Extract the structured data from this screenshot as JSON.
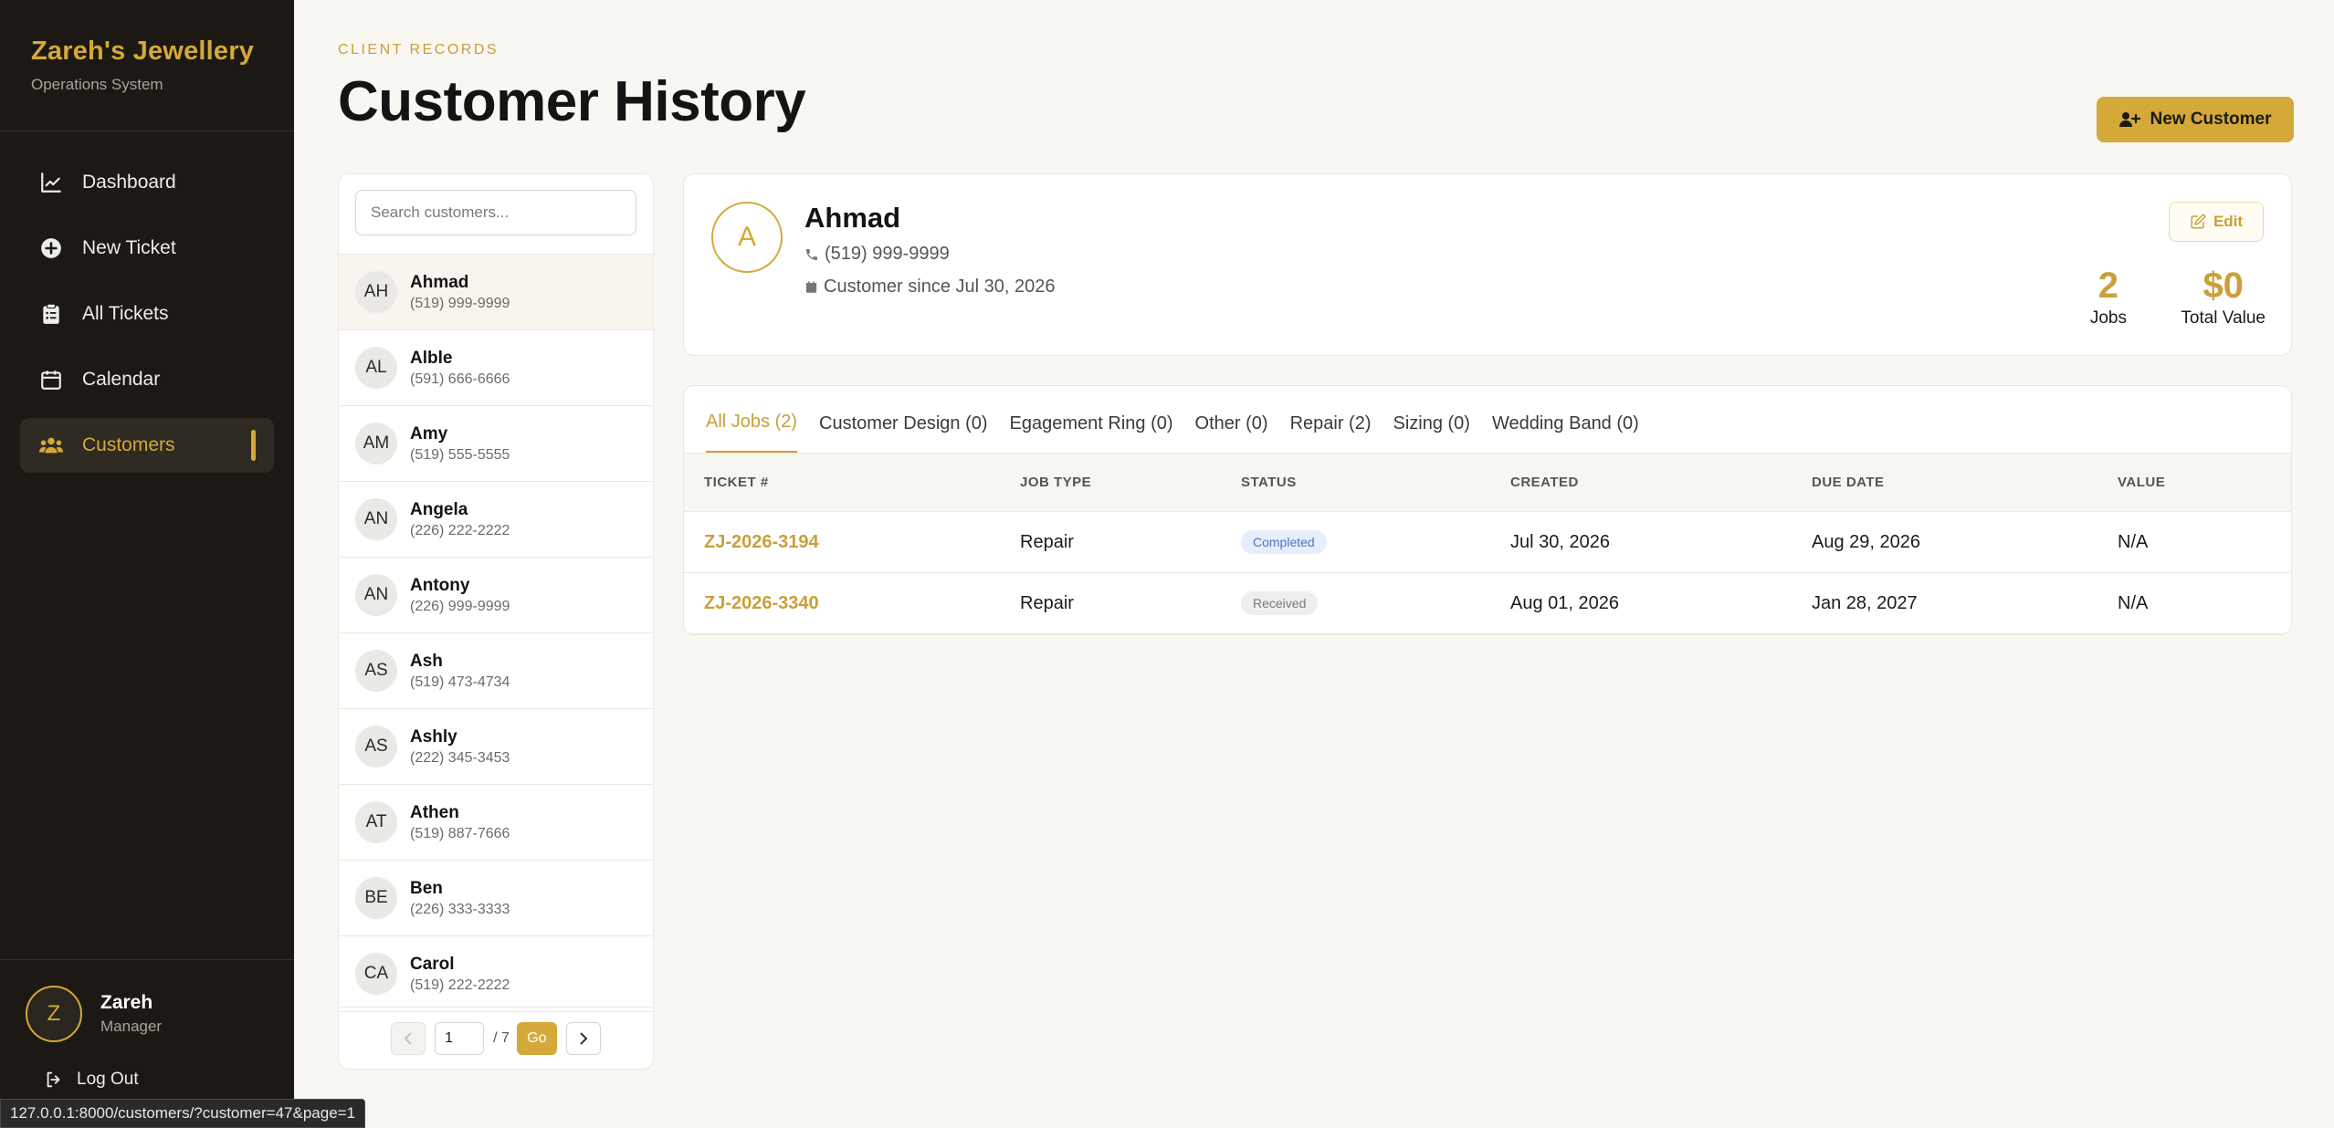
{
  "sidebar": {
    "brand_title": "Zareh's Jewellery",
    "brand_sub": "Operations System",
    "nav": [
      {
        "label": "Dashboard",
        "icon": "chart-line-icon"
      },
      {
        "label": "New Ticket",
        "icon": "plus-circle-icon"
      },
      {
        "label": "All Tickets",
        "icon": "clipboard-list-icon"
      },
      {
        "label": "Calendar",
        "icon": "calendar-icon"
      },
      {
        "label": "Customers",
        "icon": "users-icon",
        "active": true
      }
    ],
    "user": {
      "initial": "Z",
      "name": "Zareh",
      "role": "Manager"
    },
    "logout_label": "Log Out"
  },
  "statusbar": {
    "url": "127.0.0.1:8000/customers/?customer=47&page=1"
  },
  "header": {
    "eyebrow": "CLIENT RECORDS",
    "title": "Customer History",
    "new_customer_label": "New Customer"
  },
  "customer_list": {
    "search_placeholder": "Search customers...",
    "customers": [
      {
        "initials": "AH",
        "name": "Ahmad",
        "phone": "(519) 999-9999",
        "active": true
      },
      {
        "initials": "AL",
        "name": "Alble",
        "phone": "(591) 666-6666"
      },
      {
        "initials": "AM",
        "name": "Amy",
        "phone": "(519) 555-5555"
      },
      {
        "initials": "AN",
        "name": "Angela",
        "phone": "(226) 222-2222"
      },
      {
        "initials": "AN",
        "name": "Antony",
        "phone": "(226) 999-9999"
      },
      {
        "initials": "AS",
        "name": "Ash",
        "phone": "(519) 473-4734"
      },
      {
        "initials": "AS",
        "name": "Ashly",
        "phone": "(222) 345-3453"
      },
      {
        "initials": "AT",
        "name": "Athen",
        "phone": "(519) 887-7666"
      },
      {
        "initials": "BE",
        "name": "Ben",
        "phone": "(226) 333-3333"
      },
      {
        "initials": "CA",
        "name": "Carol",
        "phone": "(519) 222-2222"
      }
    ],
    "pagination": {
      "page": "1",
      "total": "/ 7",
      "go_label": "Go"
    }
  },
  "profile": {
    "initial": "A",
    "name": "Ahmad",
    "phone": "(519) 999-9999",
    "since": "Customer since Jul 30, 2026",
    "edit_label": "Edit",
    "stats": [
      {
        "value": "2",
        "label": "Jobs"
      },
      {
        "value": "$0",
        "label": "Total Value"
      }
    ]
  },
  "jobs": {
    "tabs": [
      {
        "label": "All Jobs (2)",
        "active": true
      },
      {
        "label": "Customer Design (0)"
      },
      {
        "label": "Egagement Ring (0)"
      },
      {
        "label": "Other (0)"
      },
      {
        "label": "Repair (2)"
      },
      {
        "label": "Sizing (0)"
      },
      {
        "label": "Wedding Band (0)"
      }
    ],
    "columns": [
      "TICKET #",
      "JOB TYPE",
      "STATUS",
      "CREATED",
      "DUE DATE",
      "VALUE"
    ],
    "rows": [
      {
        "ticket": "ZJ-2026-3194",
        "type": "Repair",
        "status": "Completed",
        "status_kind": "completed",
        "created": "Jul 30, 2026",
        "due": "Aug 29, 2026",
        "value": "N/A"
      },
      {
        "ticket": "ZJ-2026-3340",
        "type": "Repair",
        "status": "Received",
        "status_kind": "received",
        "created": "Aug 01, 2026",
        "due": "Jan 28, 2027",
        "value": "N/A"
      }
    ]
  },
  "colors": {
    "accent": "#d4a93a",
    "sidebar_bg": "#1c1915",
    "page_bg": "#f9f7f2"
  }
}
